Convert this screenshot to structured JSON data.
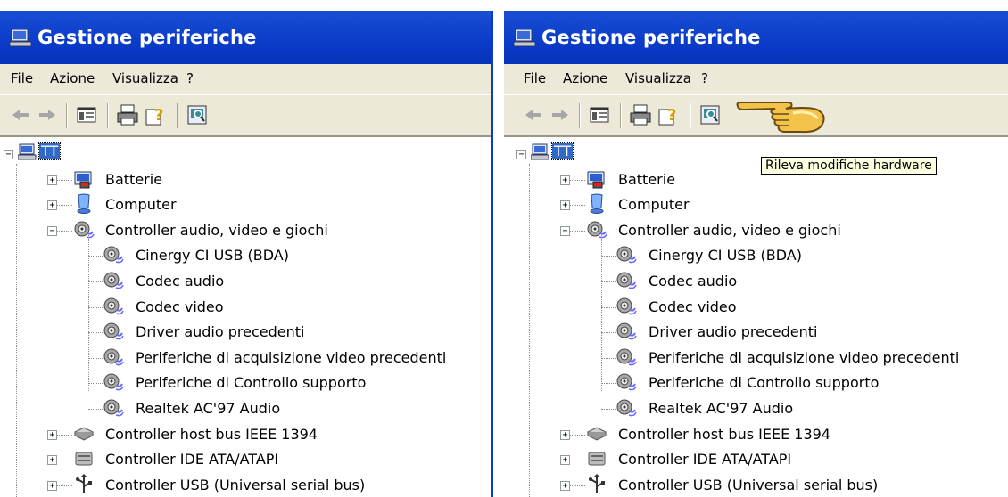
{
  "window": {
    "title": "Gestione periferiche"
  },
  "menu": [
    "File",
    "Azione",
    "Visualizza",
    "?"
  ],
  "tree": {
    "root": "TT",
    "categories": [
      {
        "label": "Batterie",
        "icon": "battery-icon",
        "expanded": false
      },
      {
        "label": "Computer",
        "icon": "computer-icon",
        "expanded": false
      },
      {
        "label": "Controller audio, video e giochi",
        "icon": "speaker-icon",
        "expanded": true,
        "children": [
          "Cinergy CI USB (BDA)",
          "Codec audio",
          "Codec video",
          "Driver audio precedenti",
          "Periferiche di acquisizione video precedenti",
          "Periferiche di Controllo supporto",
          "Realtek AC'97 Audio"
        ]
      },
      {
        "label": "Controller host bus IEEE 1394",
        "icon": "ieee1394-icon",
        "expanded": false
      },
      {
        "label": "Controller IDE ATA/ATAPI",
        "icon": "ide-icon",
        "expanded": false
      },
      {
        "label": "Controller USB (Universal serial bus)",
        "icon": "usb-icon",
        "expanded": false
      }
    ]
  },
  "tooltip": {
    "text": "Rileva modifiche hardware"
  },
  "colors": {
    "titlebar": "#0a3bc9",
    "chrome": "#ece9d8",
    "tooltip_bg": "#ffffe1"
  }
}
